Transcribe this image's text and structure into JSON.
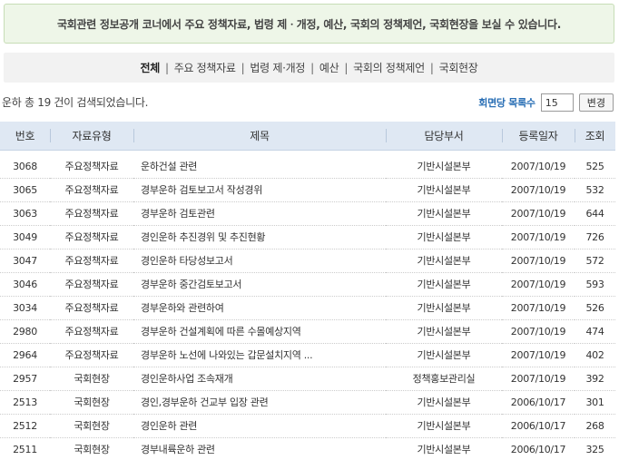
{
  "notice": "국회관련 정보공개 코너에서 주요 정책자료, 법령 제ㆍ개정, 예산, 국회의 정책제언, 국회현장을 보실 수 있습니다.",
  "tabs": [
    {
      "label": "전체",
      "active": true
    },
    {
      "label": "주요 정책자료",
      "active": false
    },
    {
      "label": "법령 제·개정",
      "active": false
    },
    {
      "label": "예산",
      "active": false
    },
    {
      "label": "국회의 정책제언",
      "active": false
    },
    {
      "label": "국회현장",
      "active": false
    }
  ],
  "tab_separator": "|",
  "result_count": "운하 총 19 건이 검색되었습니다.",
  "page_size": {
    "label": "회면당 목록수",
    "value": "15",
    "button": "변경"
  },
  "table": {
    "columns": [
      "번호",
      "자료유형",
      "제목",
      "담당부서",
      "등록일자",
      "조회"
    ],
    "rows": [
      [
        "3068",
        "주요정책자료",
        "운하건설 관련",
        "기반시설본부",
        "2007/10/19",
        "525"
      ],
      [
        "3065",
        "주요정책자료",
        "경부운하 검토보고서 작성경위",
        "기반시설본부",
        "2007/10/19",
        "532"
      ],
      [
        "3063",
        "주요정책자료",
        "경부운하 검토관련",
        "기반시설본부",
        "2007/10/19",
        "644"
      ],
      [
        "3049",
        "주요정책자료",
        "경인운하 추진경위 및 추진현황",
        "기반시설본부",
        "2007/10/19",
        "726"
      ],
      [
        "3047",
        "주요정책자료",
        "경인운하 타당성보고서",
        "기반시설본부",
        "2007/10/19",
        "572"
      ],
      [
        "3046",
        "주요정책자료",
        "경부운하 중간검토보고서",
        "기반시설본부",
        "2007/10/19",
        "593"
      ],
      [
        "3034",
        "주요정책자료",
        "경부운하와 관련하여",
        "기반시설본부",
        "2007/10/19",
        "526"
      ],
      [
        "2980",
        "주요정책자료",
        "경부운하 건설계획에 따른 수몰예상지역",
        "기반시설본부",
        "2007/10/19",
        "474"
      ],
      [
        "2964",
        "주요정책자료",
        "경부운하 노선에 나와있는 갑문설치지역 ...",
        "기반시설본부",
        "2007/10/19",
        "402"
      ],
      [
        "2957",
        "국회현장",
        "경인운하사업 조속재개",
        "정책홍보관리실",
        "2007/10/19",
        "392"
      ],
      [
        "2513",
        "국회현장",
        "경인,경부운하 건교부 입장 관련",
        "기반시설본부",
        "2006/10/17",
        "301"
      ],
      [
        "2512",
        "국회현장",
        "경인운하 관련",
        "기반시설본부",
        "2006/10/17",
        "268"
      ],
      [
        "2511",
        "국회현장",
        "경부내륙운하 관련",
        "기반시설본부",
        "2006/10/17",
        "325"
      ]
    ]
  }
}
